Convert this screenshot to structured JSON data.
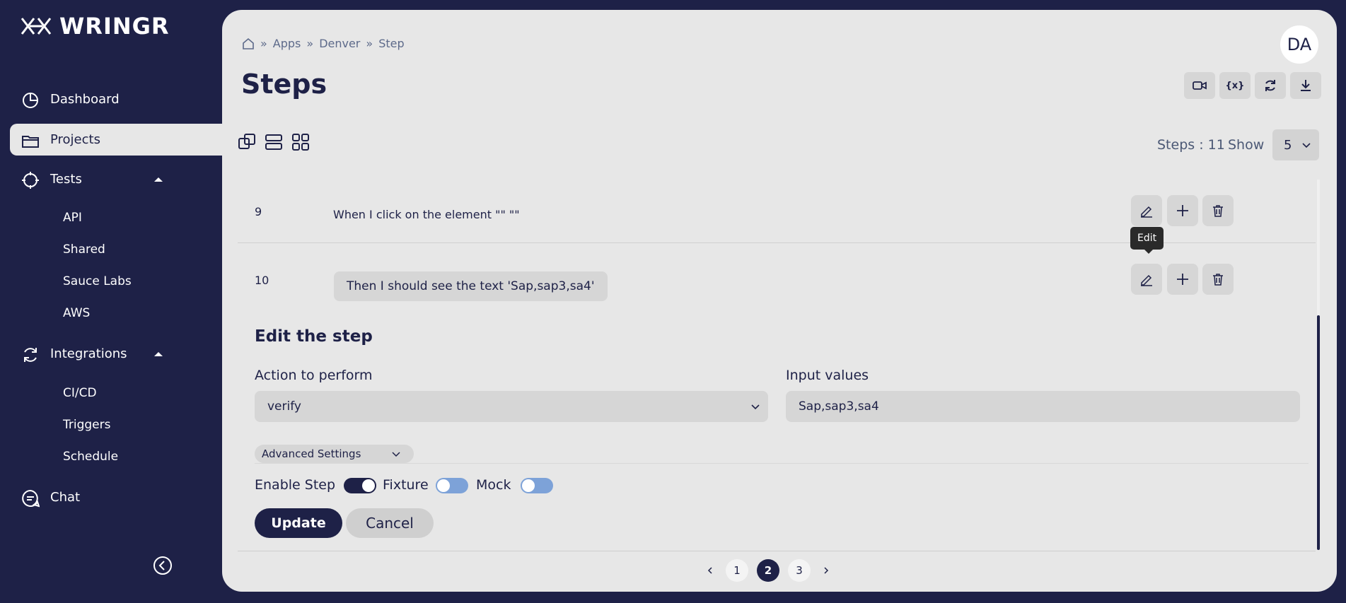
{
  "app": {
    "name": "WRINGR"
  },
  "sidebar": {
    "items": [
      {
        "label": "Dashboard",
        "icon": "dashboard-icon"
      },
      {
        "label": "Projects",
        "icon": "folder-icon",
        "active": true
      },
      {
        "label": "Tests",
        "icon": "crosshair-icon",
        "expanded": true
      },
      {
        "label": "Integrations",
        "icon": "refresh-icon",
        "expanded": true
      },
      {
        "label": "Chat",
        "icon": "chat-icon"
      }
    ],
    "tests_sub": [
      "API",
      "Shared",
      "Sauce Labs",
      "AWS"
    ],
    "integrations_sub": [
      "CI/CD",
      "Triggers",
      "Schedule"
    ]
  },
  "breadcrumb": [
    "Apps",
    "Denver",
    "Step"
  ],
  "header": {
    "title": "Steps",
    "avatar": "DA"
  },
  "summary": {
    "steps_count": "Steps : 11",
    "show_label": "Show",
    "show_value": "5"
  },
  "steps": [
    {
      "number": "9",
      "text": "When I click on the element \"\" \"\""
    },
    {
      "number": "10",
      "text": "Then I should see the text 'Sap,sap3,sa4'"
    }
  ],
  "tooltip": "Edit",
  "edit": {
    "title": "Edit the step",
    "action_label": "Action to perform",
    "action_value": "verify",
    "input_label": "Input values",
    "input_value": "Sap,sap3,sa4",
    "advanced": "Advanced Settings",
    "toggles": [
      {
        "label": "Enable Step",
        "on": true
      },
      {
        "label": "Fixture",
        "on": false
      },
      {
        "label": "Mock",
        "on": false
      }
    ],
    "update": "Update",
    "cancel": "Cancel"
  },
  "pagination": {
    "pages": [
      "1",
      "2",
      "3"
    ],
    "current": "2"
  },
  "colors": {
    "primary": "#1e2147",
    "panel": "#e7e7e7",
    "toggle_off": "#7da2d8"
  }
}
